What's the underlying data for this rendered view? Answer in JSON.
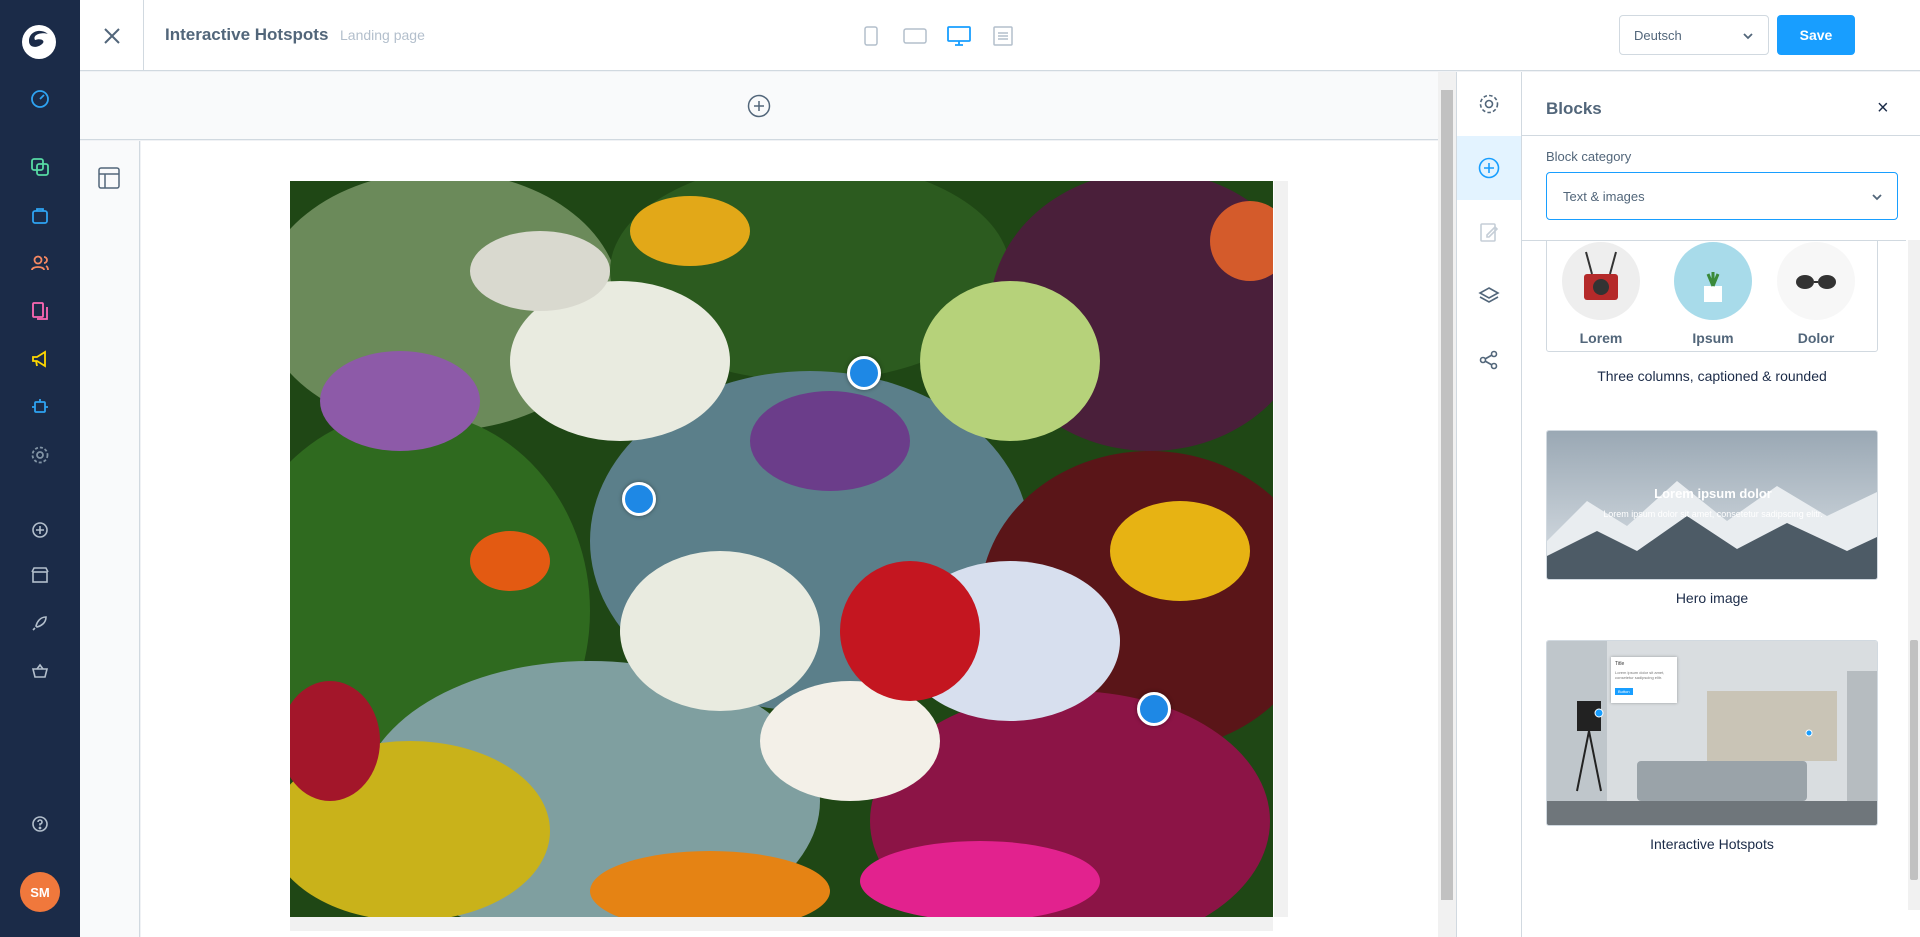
{
  "nav": {
    "avatar_initials": "SM",
    "items": [
      "dashboard-icon",
      "catalogues-icon",
      "orders-icon",
      "customers-icon",
      "content-icon",
      "marketing-icon",
      "extensions-icon",
      "settings-icon",
      "add-icon",
      "store-icon",
      "rocket-icon",
      "basket-icon",
      "help-icon"
    ]
  },
  "topbar": {
    "title": "Interactive Hotspots",
    "subtitle": "Landing page",
    "language": "Deutsch",
    "save_label": "Save",
    "viewports": [
      "mobile",
      "tablet",
      "desktop",
      "form"
    ],
    "active_viewport": "desktop"
  },
  "panel": {
    "title": "Blocks",
    "category_label": "Block category",
    "category_value": "Text & images",
    "blocks": [
      {
        "name": "Three columns, captioned & rounded",
        "captions": [
          "Lorem",
          "Ipsum",
          "Dolor"
        ]
      },
      {
        "name": "Hero image",
        "overlay_title": "Lorem ipsum dolor",
        "overlay_text": "Lorem ipsum dolor sit amet, consetetur sadipscing elitr."
      },
      {
        "name": "Interactive Hotspots",
        "mini_title": "Title",
        "mini_text": "Lorem ipsum dolor sit amet, consetetur sadipscing elitr.",
        "mini_button": "Button"
      }
    ]
  },
  "colors": {
    "accent": "#189eff",
    "nav_bg": "#1b2b48",
    "avatar": "#f0783c",
    "hotspot": "#1e88e5"
  }
}
